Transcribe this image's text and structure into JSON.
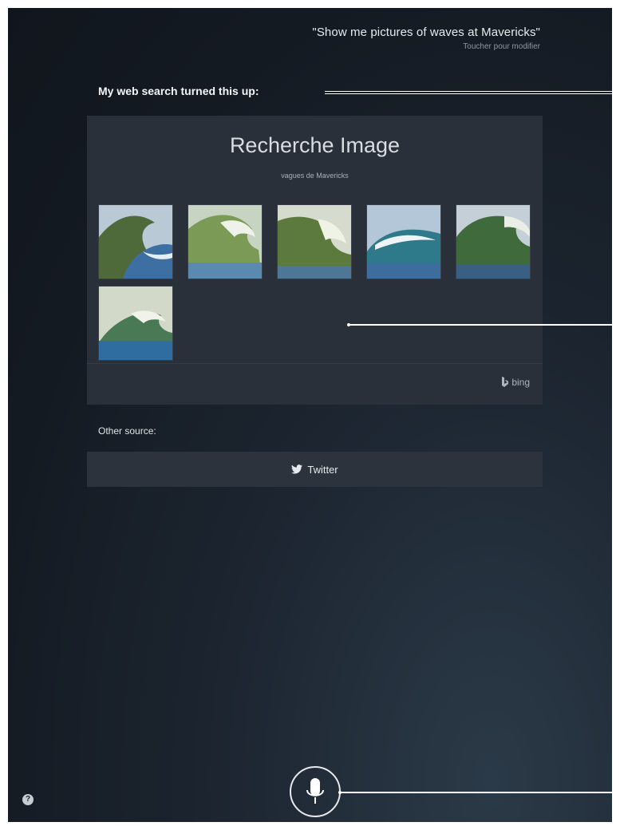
{
  "siri": {
    "query": "\"Show me pictures of waves at Mavericks\"",
    "edit_hint": "Toucher pour modifier",
    "result_heading": "My web search turned this up:"
  },
  "image_search": {
    "title": "Recherche Image",
    "subtitle": "vagues de Mavericks",
    "thumbnails": [
      {
        "icon": "wave-photo"
      },
      {
        "icon": "wave-photo"
      },
      {
        "icon": "wave-photo"
      },
      {
        "icon": "wave-photo"
      },
      {
        "icon": "wave-photo"
      },
      {
        "icon": "wave-photo"
      }
    ],
    "provider": "bing"
  },
  "other_sources": {
    "label": "Other source:",
    "twitter_label": "Twitter"
  },
  "controls": {
    "help_label": "?",
    "mic_icon": "microphone-icon"
  },
  "colors": {
    "background": "#141a22",
    "card": "#2a3039",
    "text": "#e8ebee"
  }
}
